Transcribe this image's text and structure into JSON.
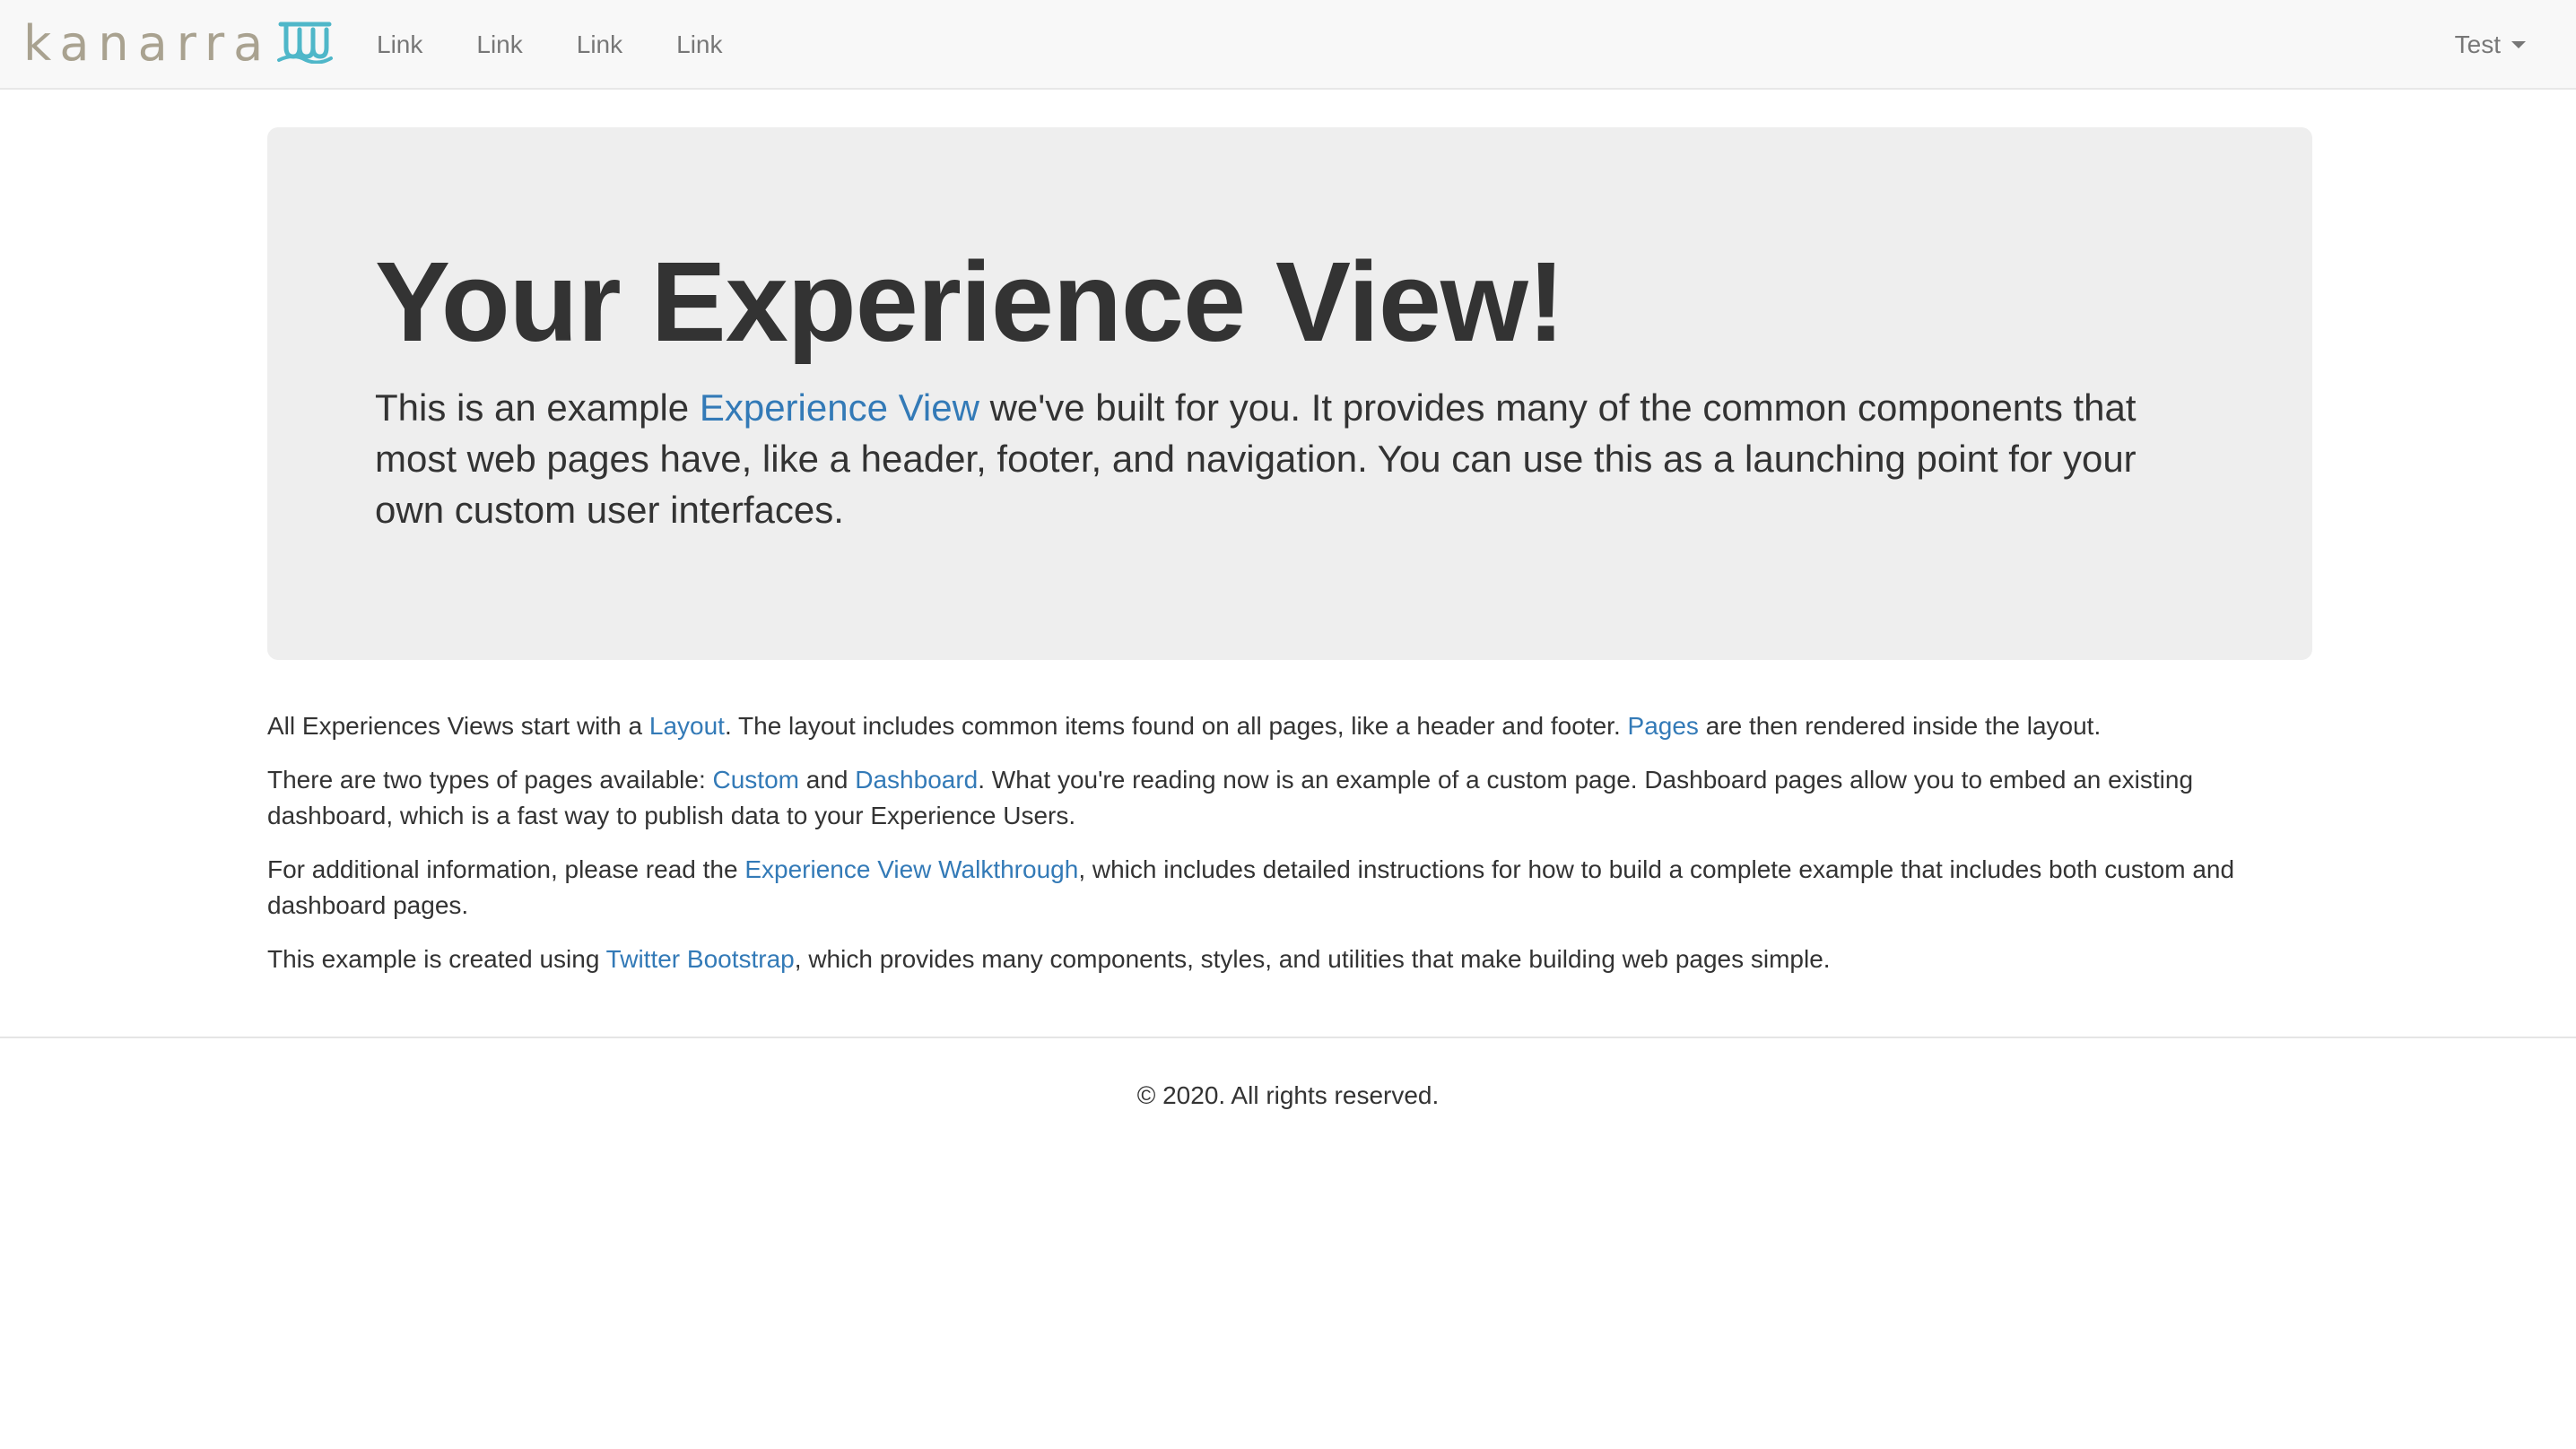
{
  "navbar": {
    "brand": "kanarra",
    "brand_icon": "kanarra-waves-icon",
    "links": [
      "Link",
      "Link",
      "Link",
      "Link"
    ],
    "user_menu": "Test",
    "colors": {
      "brand_text": "#a9a290",
      "brand_mark": "#4fb7c9",
      "background": "#f8f8f8"
    }
  },
  "jumbotron": {
    "title": "Your Experience View!",
    "lead_before": "This is an example ",
    "lead_link": "Experience View",
    "lead_after": " we've built for you. It provides many of the common components that most web pages have, like a header, footer, and navigation. You can use this as a launching point for your own custom user interfaces."
  },
  "content": {
    "p1": {
      "t1": "All Experiences Views start with a ",
      "link1": "Layout",
      "t2": ". The layout includes common items found on all pages, like a header and footer. ",
      "link2": "Pages",
      "t3": " are then rendered inside the layout."
    },
    "p2": {
      "t1": "There are two types of pages available: ",
      "link1": "Custom",
      "t2": " and ",
      "link2": "Dashboard",
      "t3": ". What you're reading now is an example of a custom page. Dashboard pages allow you to embed an existing dashboard, which is a fast way to publish data to your Experience Users."
    },
    "p3": {
      "t1": "For additional information, please read the ",
      "link1": "Experience View Walkthrough",
      "t2": ", which includes detailed instructions for how to build a complete example that includes both custom and dashboard pages."
    },
    "p4": {
      "t1": "This example is created using ",
      "link1": "Twitter Bootstrap",
      "t2": ", which provides many components, styles, and utilities that make building web pages simple."
    }
  },
  "footer": {
    "copyright": "© 2020. All rights reserved."
  },
  "colors": {
    "link": "#337ab7",
    "text": "#333333",
    "jumbotron_bg": "#eeeeee"
  }
}
